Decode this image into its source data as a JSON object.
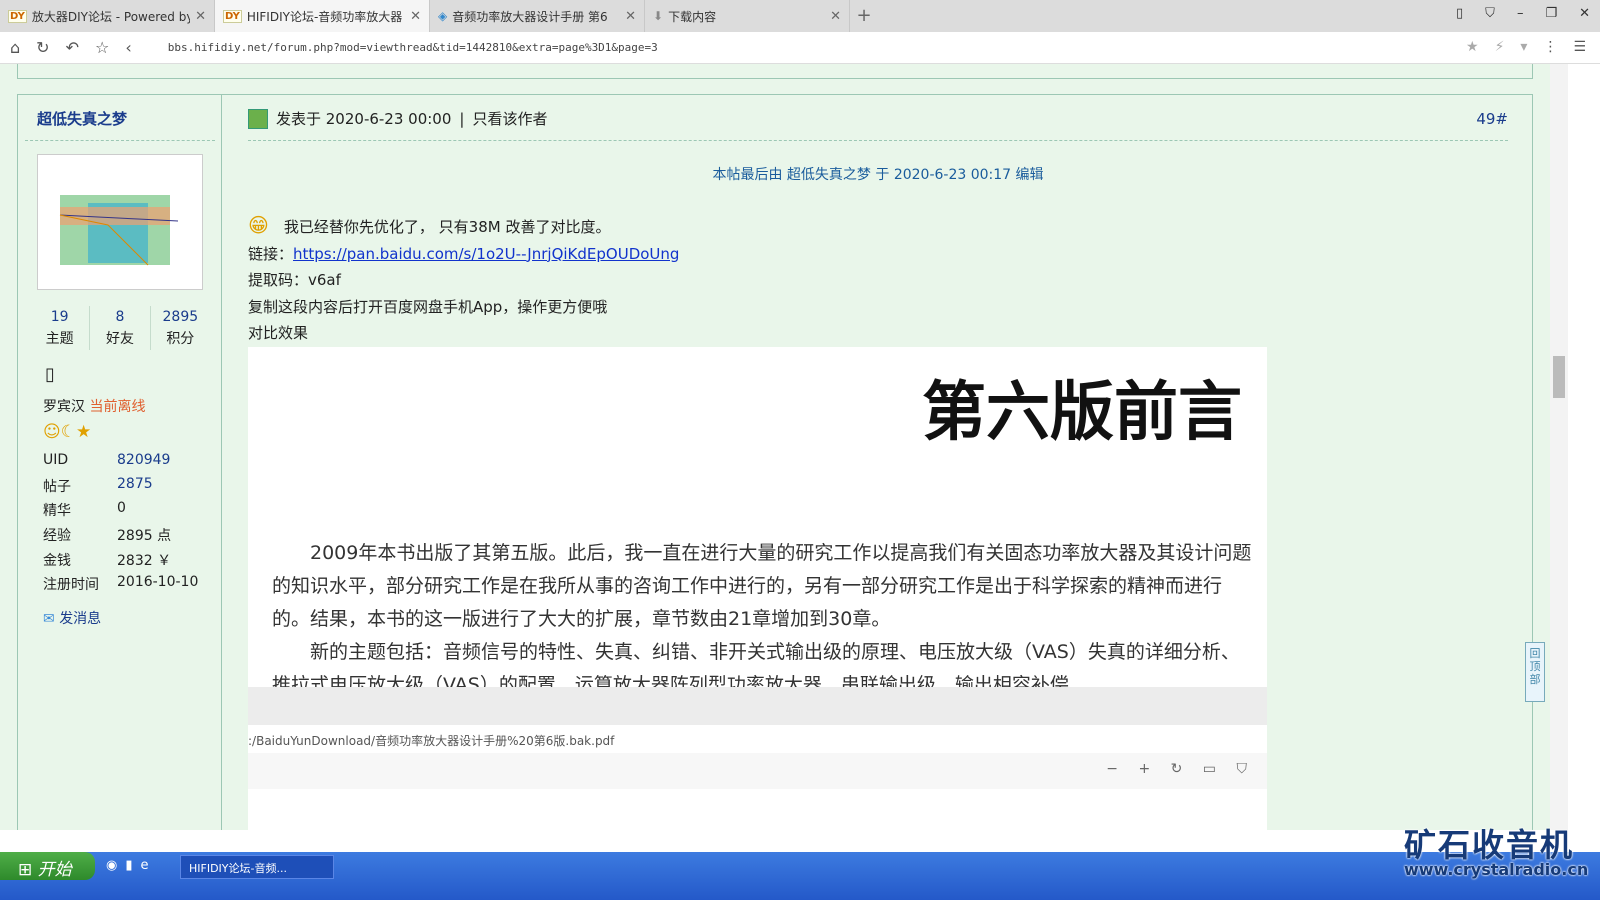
{
  "browser": {
    "tabs": [
      {
        "label": "放大器DIY论坛 - Powered by",
        "favicon": "DY",
        "active": false
      },
      {
        "label": "HIFIDIY论坛-音频功率放大器",
        "favicon": "DY",
        "active": true
      },
      {
        "label": "音频功率放大器设计手册 第6",
        "favicon": "◈",
        "active": false
      },
      {
        "label": "下载内容",
        "favicon": "⬇",
        "active": false
      }
    ],
    "url": "bbs.hifidiy.net/forum.php?mod=viewthread&tid=1442810&extra=page%3D1&page=3"
  },
  "user": {
    "name": "超低失真之梦",
    "stats": [
      {
        "value": "19",
        "label": "主题"
      },
      {
        "value": "8",
        "label": "好友"
      },
      {
        "value": "2895",
        "label": "积分"
      }
    ],
    "rank": "罗宾汉",
    "status": "当前离线",
    "profile": [
      {
        "k": "UID",
        "v": "820949"
      },
      {
        "k": "帖子",
        "v": "2875"
      },
      {
        "k": "精华",
        "v": "0"
      },
      {
        "k": "经验",
        "v": "2895 点"
      },
      {
        "k": "金钱",
        "v": "2832 ￥"
      },
      {
        "k": "注册时间",
        "v": "2016-10-10"
      }
    ],
    "message": "发消息"
  },
  "post": {
    "posted": "发表于 2020-6-23 00:00",
    "sep": "|",
    "only_author": "只看该作者",
    "floor": "49#",
    "edit_note": "本帖最后由 超低失真之梦 于 2020-6-23 00:17 编辑",
    "line1": "我已经替你先优化了，  只有38M  改善了对比度。",
    "link_label": "链接：",
    "link": "https://pan.baidu.com/s/1o2U--JnrjQiKdEpOUDoUng",
    "code_label": "提取码：",
    "code": "v6af",
    "line3": "复制这段内容后打开百度网盘手机App，操作更方便哦",
    "line4": "对比效果"
  },
  "image": {
    "title": "第六版前言",
    "text": "　　2009年本书出版了其第五版。此后，我一直在进行大量的研究工作以提高我们有关固态功率放大器及其设计问题的知识水平，部分研究工作是在我所从事的咨询工作中进行的，另有一部分研究工作是出于科学探索的精神而进行的。结果，本书的这一版进行了大大的扩展，章节数由21章增加到30章。\n　　新的主题包括：音频信号的特性、失真、纠错、非开关式输出级的原理、电压放大级（VAS）失真的详细分析、推拉式电压放大级（VAS）的配置、运算放大器阵列型功率放大器、串联输出级、输出相容补偿",
    "path": ":/BaiduYunDownload/音频功率放大器设计手册%20第6版.bak.pdf",
    "tools": "− + ↻ ▭ ⛉"
  },
  "backtop": "回顶部",
  "taskbar": {
    "start": "开始",
    "task": "HIFIDIY论坛-音频..."
  },
  "watermark": {
    "cn": "矿石收音机",
    "url": "www.crystalradio.cn"
  }
}
